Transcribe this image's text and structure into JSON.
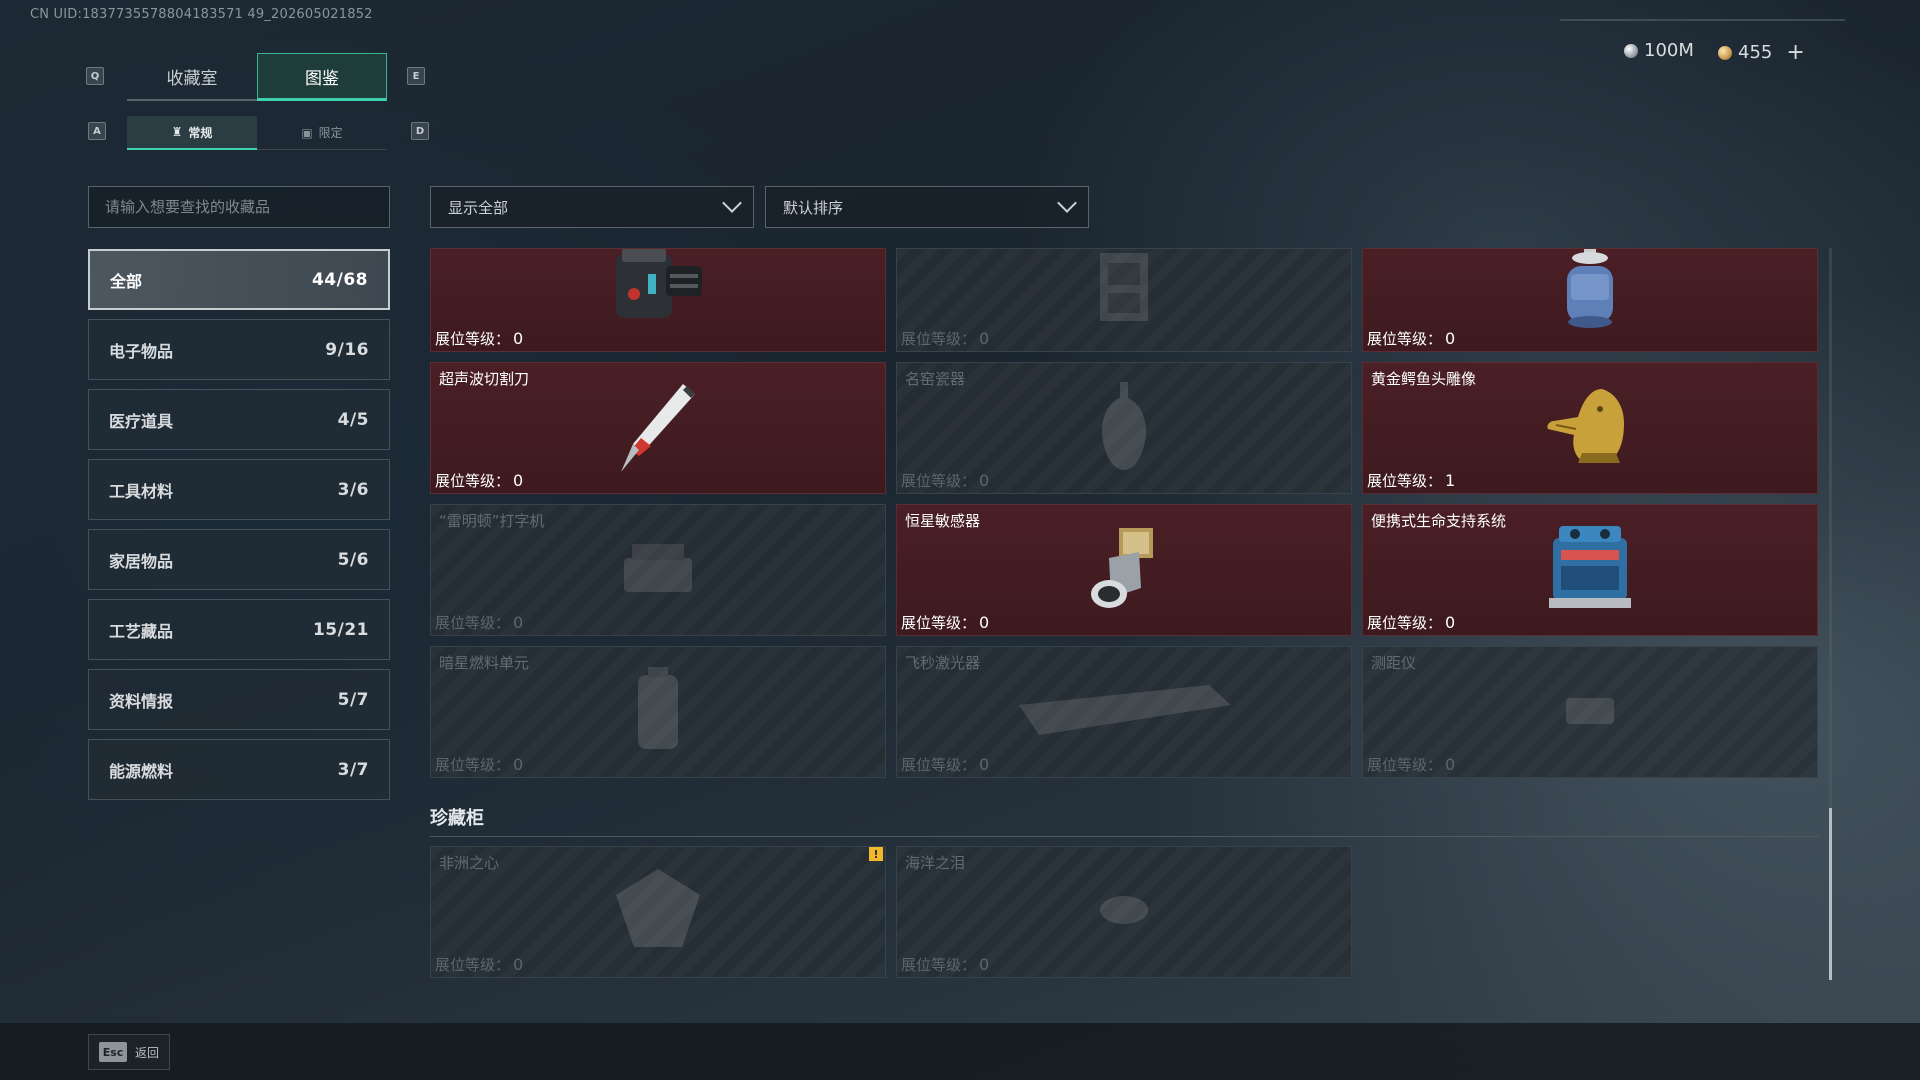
{
  "uid": "CN UID:1837735578804183571 49_202605021852",
  "keys": {
    "q": "Q",
    "e": "E",
    "a": "A",
    "d": "D"
  },
  "tabs": [
    {
      "label": "收藏室",
      "active": false
    },
    {
      "label": "图鉴",
      "active": true
    }
  ],
  "subtabs": [
    {
      "label": "常规",
      "icon": "bottle-icon",
      "glyph": "♜",
      "active": true
    },
    {
      "label": "限定",
      "icon": "image-icon",
      "glyph": "▣",
      "active": false
    }
  ],
  "currency": {
    "silver": {
      "value": "100M",
      "icon": "silver-coin-icon"
    },
    "gold": {
      "value": "455",
      "icon": "gold-coin-icon",
      "plus": "+"
    }
  },
  "search": {
    "placeholder": "请输入想要查找的收藏品"
  },
  "categories": [
    {
      "label": "全部",
      "count": "44/68",
      "active": true
    },
    {
      "label": "电子物品",
      "count": "9/16"
    },
    {
      "label": "医疗道具",
      "count": "4/5"
    },
    {
      "label": "工具材料",
      "count": "3/6"
    },
    {
      "label": "家居物品",
      "count": "5/6"
    },
    {
      "label": "工艺藏品",
      "count": "15/21"
    },
    {
      "label": "资料情报",
      "count": "5/7"
    },
    {
      "label": "能源燃料",
      "count": "3/7"
    }
  ],
  "filters": {
    "show": "显示全部",
    "sort": "默认排序"
  },
  "level_label": "展位等级：",
  "items": [
    {
      "name": "",
      "level": "0",
      "locked": false,
      "icon": "device-icon"
    },
    {
      "name": "",
      "level": "0",
      "locked": true,
      "icon": "cabinet-icon"
    },
    {
      "name": "",
      "level": "0",
      "locked": false,
      "icon": "gas-canister-icon"
    },
    {
      "name": "超声波切割刀",
      "level": "0",
      "locked": false,
      "icon": "cutter-icon"
    },
    {
      "name": "名窑瓷器",
      "level": "0",
      "locked": true,
      "icon": "vase-icon"
    },
    {
      "name": "黄金鳄鱼头雕像",
      "level": "1",
      "locked": false,
      "icon": "crocodile-statue-icon"
    },
    {
      "name": "“雷明顿”打字机",
      "level": "0",
      "locked": true,
      "icon": "typewriter-icon"
    },
    {
      "name": "恒星敏感器",
      "level": "0",
      "locked": false,
      "icon": "star-sensor-icon"
    },
    {
      "name": "便携式生命支持系统",
      "level": "0",
      "locked": false,
      "icon": "life-support-icon"
    },
    {
      "name": "暗星燃料单元",
      "level": "0",
      "locked": true,
      "icon": "fuel-cell-icon"
    },
    {
      "name": "飞秒激光器",
      "level": "0",
      "locked": true,
      "icon": "laser-icon"
    },
    {
      "name": "测距仪",
      "level": "0",
      "locked": true,
      "icon": "rangefinder-icon"
    }
  ],
  "section": {
    "title": "珍藏柜"
  },
  "treasures": [
    {
      "name": "非洲之心",
      "level": "0",
      "locked": true,
      "icon": "diamond-icon",
      "warning": "!"
    },
    {
      "name": "海洋之泪",
      "level": "0",
      "locked": true,
      "icon": "gem-icon"
    }
  ],
  "footer": {
    "key": "Esc",
    "label": "返回"
  }
}
